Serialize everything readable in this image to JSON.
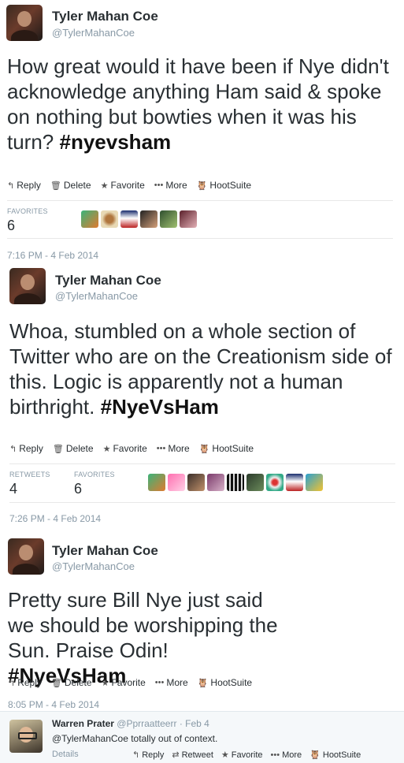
{
  "tweets": [
    {
      "name": "Tyler Mahan Coe",
      "handle": "@TylerMahanCoe",
      "text": "How great would it have been if Nye didn't acknowledge anything Ham said & spoke on nothing but bowties when it was his turn? ",
      "hashtag": "#nyevsham",
      "actions": {
        "reply": "Reply",
        "delete": "Delete",
        "favorite": "Favorite",
        "more": "More",
        "hootsuite": "HootSuite"
      },
      "favorites_label": "FAVORITES",
      "favorites_count": "6",
      "timestamp": "7:16 PM - 4 Feb 2014"
    },
    {
      "name": "Tyler Mahan Coe",
      "handle": "@TylerMahanCoe",
      "text": "Whoa, stumbled on a whole section of Twitter who are on the Creationism side of this. Logic is apparently not a human birthright. ",
      "hashtag": "#NyeVsHam",
      "actions": {
        "reply": "Reply",
        "delete": "Delete",
        "favorite": "Favorite",
        "more": "More",
        "hootsuite": "HootSuite"
      },
      "retweets_label": "RETWEETS",
      "retweets_count": "4",
      "favorites_label": "FAVORITES",
      "favorites_count": "6",
      "timestamp": "7:26 PM - 4 Feb 2014"
    },
    {
      "name": "Tyler Mahan Coe",
      "handle": "@TylerMahanCoe",
      "text": "Pretty sure Bill Nye just said we should be worshipping the Sun. Praise Odin! ",
      "hashtag": "#NyeVsHam",
      "actions": {
        "reply": "Reply",
        "delete": "Delete",
        "favorite": "Favorite",
        "more": "More",
        "hootsuite": "HootSuite"
      },
      "timestamp": "8:05 PM - 4 Feb 2014"
    }
  ],
  "reply": {
    "name": "Warren Prater",
    "handle": "@Pprraatteerr",
    "date": "· Feb 4",
    "text": "@TylerMahanCoe totally out of context.",
    "details": "Details",
    "actions": {
      "reply": "Reply",
      "retweet": "Retweet",
      "favorite": "Favorite",
      "more": "More",
      "hootsuite": "HootSuite"
    }
  },
  "icons": {
    "reply": "reply-arrow-icon",
    "delete": "trash-icon",
    "favorite": "star-icon",
    "more": "ellipsis-icon",
    "hootsuite": "hootsuite-owl-icon",
    "retweet": "retweet-icon"
  },
  "colors": {
    "name": "#292f33",
    "muted": "#8899a6",
    "reply_bg": "#f5f8fa"
  }
}
